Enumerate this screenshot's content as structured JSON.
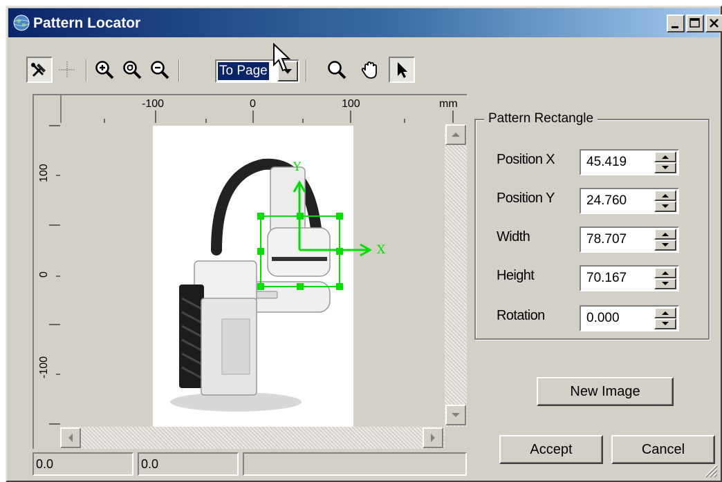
{
  "window": {
    "title": "Pattern Locator",
    "icon": "globe-icon",
    "controls": [
      "minimize-icon",
      "maximize-icon",
      "close-icon"
    ]
  },
  "toolbar": {
    "tools": [
      "tools-icon",
      "crosshair-icon",
      "zoom-in-icon",
      "zoom-reset-icon",
      "zoom-out-icon",
      "magnifier-icon",
      "hand-pan-icon",
      "arrow-pointer-icon"
    ],
    "zoom_value": "To Page"
  },
  "ruler": {
    "unit": "mm",
    "top_labels": [
      "-100",
      "0",
      "100"
    ],
    "left_labels": [
      "100",
      "0",
      "-100"
    ]
  },
  "canvas": {
    "axis_x_label": "X",
    "axis_y_label": "Y",
    "accent_color": "#00e000"
  },
  "status": {
    "x": "0.0",
    "y": "0.0",
    "message": ""
  },
  "pattern_rectangle": {
    "title": "Pattern Rectangle",
    "fields": [
      {
        "label": "Position X",
        "value": "45.419"
      },
      {
        "label": "Position Y",
        "value": "24.760"
      },
      {
        "label": "Width",
        "value": "78.707"
      },
      {
        "label": "Height",
        "value": "70.167"
      },
      {
        "label": "Rotation",
        "value": "0.000"
      }
    ]
  },
  "buttons": {
    "new_image": "New Image",
    "accept": "Accept",
    "cancel": "Cancel"
  }
}
